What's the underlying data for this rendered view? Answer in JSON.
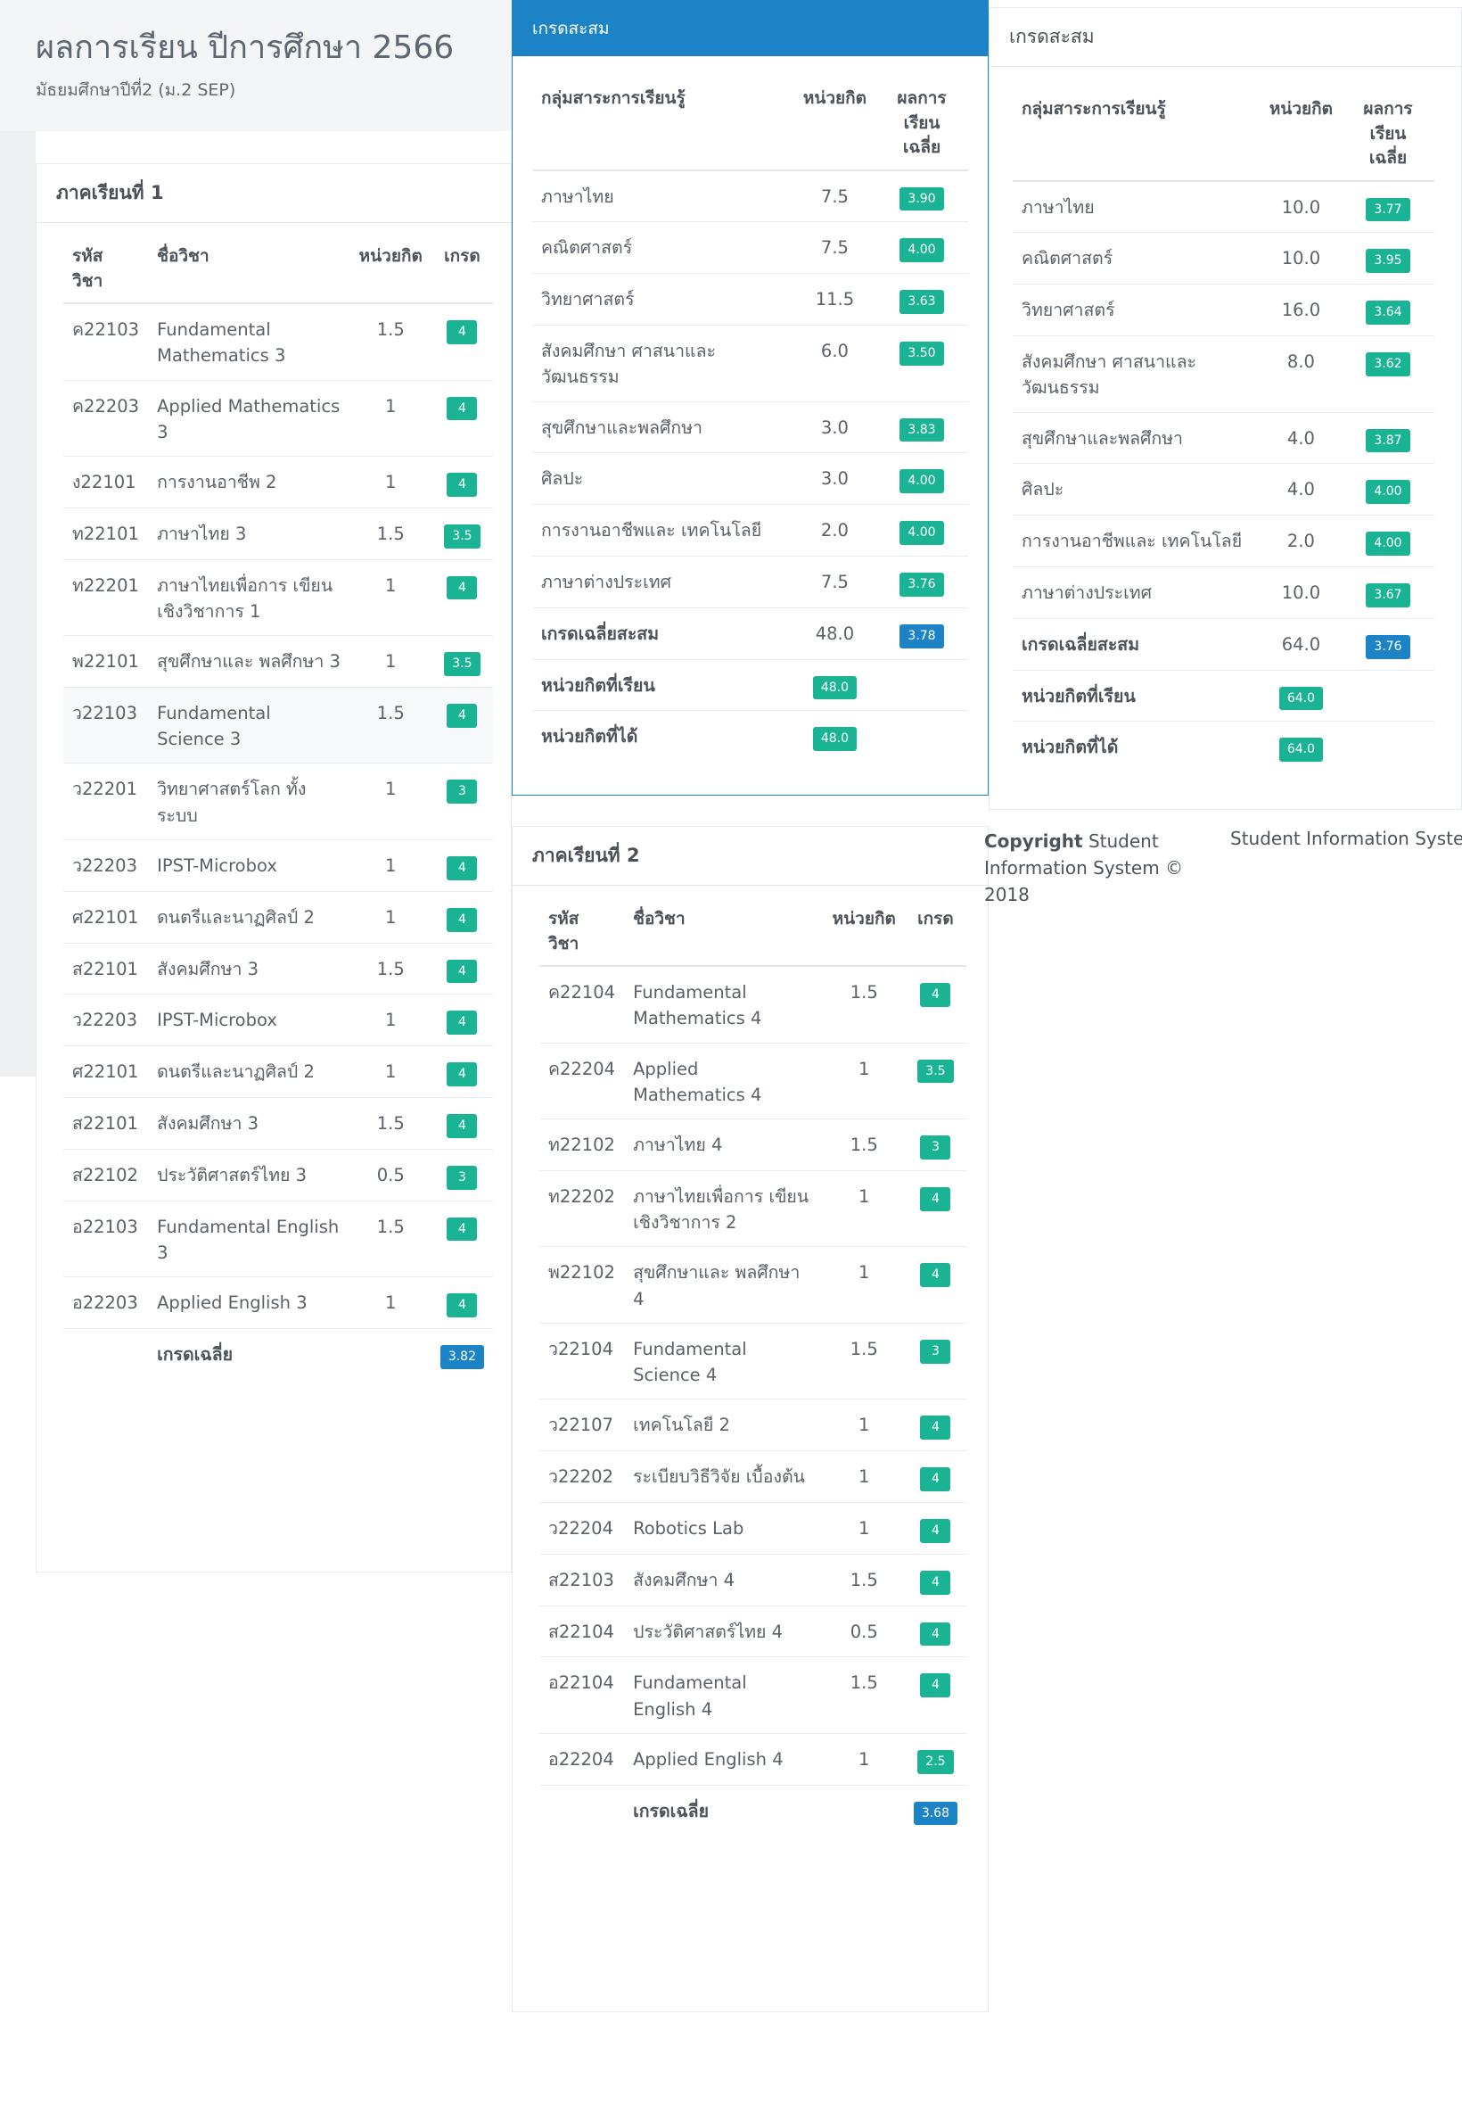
{
  "page": {
    "title": "ผลการเรียน ปีการศึกษา 2566",
    "subtitle": "มัธยมศึกษาปีที่2 (ม.2 SEP)"
  },
  "colors": {
    "green": "#1ab394",
    "blue": "#1c84c6"
  },
  "term1": {
    "heading": "ภาคเรียนที่ 1",
    "headers": {
      "code": "รหัส วิชา",
      "name": "ชื่อวิชา",
      "credit": "หน่วยกิต",
      "grade": "เกรด"
    },
    "rows": [
      {
        "code": "ค22103",
        "name": "Fundamental Mathematics 3",
        "credit": "1.5",
        "grade": "4"
      },
      {
        "code": "ค22203",
        "name": "Applied Mathematics 3",
        "credit": "1",
        "grade": "4"
      },
      {
        "code": "ง22101",
        "name": "การงานอาชีพ 2",
        "credit": "1",
        "grade": "4"
      },
      {
        "code": "ท22101",
        "name": "ภาษาไทย 3",
        "credit": "1.5",
        "grade": "3.5"
      },
      {
        "code": "ท22201",
        "name": "ภาษาไทยเพื่อการ เขียนเชิงวิชาการ 1",
        "credit": "1",
        "grade": "4"
      },
      {
        "code": "พ22101",
        "name": "สุขศึกษาและ พลศึกษา 3",
        "credit": "1",
        "grade": "3.5"
      },
      {
        "code": "ว22103",
        "name": "Fundamental Science 3",
        "credit": "1.5",
        "grade": "4"
      },
      {
        "code": "ว22201",
        "name": "วิทยาศาสตร์โลก ทั้งระบบ",
        "credit": "1",
        "grade": "3"
      },
      {
        "code": "ว22203",
        "name": "IPST-Microbox",
        "credit": "1",
        "grade": "4"
      },
      {
        "code": "ศ22101",
        "name": "ดนตรีและนาฏศิลป์ 2",
        "credit": "1",
        "grade": "4"
      },
      {
        "code": "ส22101",
        "name": "สังคมศึกษา 3",
        "credit": "1.5",
        "grade": "4"
      },
      {
        "code": "ว22203",
        "name": "IPST-Microbox",
        "credit": "1",
        "grade": "4"
      },
      {
        "code": "ศ22101",
        "name": "ดนตรีและนาฏศิลป์ 2",
        "credit": "1",
        "grade": "4"
      },
      {
        "code": "ส22101",
        "name": "สังคมศึกษา 3",
        "credit": "1.5",
        "grade": "4"
      },
      {
        "code": "ส22102",
        "name": "ประวัติศาสตร์ไทย 3",
        "credit": "0.5",
        "grade": "3"
      },
      {
        "code": "อ22103",
        "name": "Fundamental English 3",
        "credit": "1.5",
        "grade": "4"
      },
      {
        "code": "อ22203",
        "name": "Applied English 3",
        "credit": "1",
        "grade": "4"
      }
    ],
    "gpa_label": "เกรดเฉลี่ย",
    "gpa": "3.82"
  },
  "term2": {
    "heading": "ภาคเรียนที่ 2",
    "headers": {
      "code": "รหัส วิชา",
      "name": "ชื่อวิชา",
      "credit": "หน่วยกิต",
      "grade": "เกรด"
    },
    "rows": [
      {
        "code": "ค22104",
        "name": "Fundamental Mathematics 4",
        "credit": "1.5",
        "grade": "4"
      },
      {
        "code": "ค22204",
        "name": "Applied Mathematics 4",
        "credit": "1",
        "grade": "3.5"
      },
      {
        "code": "ท22102",
        "name": "ภาษาไทย 4",
        "credit": "1.5",
        "grade": "3"
      },
      {
        "code": "ท22202",
        "name": "ภาษาไทยเพื่อการ เขียนเชิงวิชาการ 2",
        "credit": "1",
        "grade": "4"
      },
      {
        "code": "พ22102",
        "name": "สุขศึกษาและ พลศึกษา 4",
        "credit": "1",
        "grade": "4"
      },
      {
        "code": "ว22104",
        "name": "Fundamental Science 4",
        "credit": "1.5",
        "grade": "3"
      },
      {
        "code": "ว22107",
        "name": "เทคโนโลยี 2",
        "credit": "1",
        "grade": "4"
      },
      {
        "code": "ว22202",
        "name": "ระเบียบวิธีวิจัย เบื้องต้น",
        "credit": "1",
        "grade": "4"
      },
      {
        "code": "ว22204",
        "name": "Robotics Lab",
        "credit": "1",
        "grade": "4"
      },
      {
        "code": "ส22103",
        "name": "สังคมศึกษา 4",
        "credit": "1.5",
        "grade": "4"
      },
      {
        "code": "ส22104",
        "name": "ประวัติศาสตร์ไทย 4",
        "credit": "0.5",
        "grade": "4"
      },
      {
        "code": "อ22104",
        "name": "Fundamental English 4",
        "credit": "1.5",
        "grade": "4"
      },
      {
        "code": "อ22204",
        "name": "Applied English 4",
        "credit": "1",
        "grade": "2.5"
      }
    ],
    "gpa_label": "เกรดเฉลี่ย",
    "gpa": "3.68"
  },
  "cum1": {
    "heading": "เกรดสะสม",
    "headers": {
      "group": "กลุ่มสาระการเรียนรู้",
      "credit": "หน่วยกิต",
      "avg": "ผลการเรียน เฉลี่ย"
    },
    "rows": [
      {
        "group": "ภาษาไทย",
        "credit": "7.5",
        "avg": "3.90"
      },
      {
        "group": "คณิตศาสตร์",
        "credit": "7.5",
        "avg": "4.00"
      },
      {
        "group": "วิทยาศาสตร์",
        "credit": "11.5",
        "avg": "3.63"
      },
      {
        "group": "สังคมศึกษา ศาสนาและ วัฒนธรรม",
        "credit": "6.0",
        "avg": "3.50"
      },
      {
        "group": "สุขศึกษาและพลศึกษา",
        "credit": "3.0",
        "avg": "3.83"
      },
      {
        "group": "ศิลปะ",
        "credit": "3.0",
        "avg": "4.00"
      },
      {
        "group": "การงานอาชีพและ เทคโนโลยี",
        "credit": "2.0",
        "avg": "4.00"
      },
      {
        "group": "ภาษาต่างประเทศ",
        "credit": "7.5",
        "avg": "3.76"
      }
    ],
    "cum_label": "เกรดเฉลี่ยสะสม",
    "cum_credit": "48.0",
    "cum_gpa": "3.78",
    "credits_studied_label": "หน่วยกิตที่เรียน",
    "credits_studied": "48.0",
    "credits_earned_label": "หน่วยกิตที่ได้",
    "credits_earned": "48.0"
  },
  "cum2": {
    "heading": "เกรดสะสม",
    "headers": {
      "group": "กลุ่มสาระการเรียนรู้",
      "credit": "หน่วยกิต",
      "avg": "ผลการเรียน เฉลี่ย"
    },
    "rows": [
      {
        "group": "ภาษาไทย",
        "credit": "10.0",
        "avg": "3.77"
      },
      {
        "group": "คณิตศาสตร์",
        "credit": "10.0",
        "avg": "3.95"
      },
      {
        "group": "วิทยาศาสตร์",
        "credit": "16.0",
        "avg": "3.64"
      },
      {
        "group": "สังคมศึกษา ศาสนาและ วัฒนธรรม",
        "credit": "8.0",
        "avg": "3.62"
      },
      {
        "group": "สุขศึกษาและพลศึกษา",
        "credit": "4.0",
        "avg": "3.87"
      },
      {
        "group": "ศิลปะ",
        "credit": "4.0",
        "avg": "4.00"
      },
      {
        "group": "การงานอาชีพและ เทคโนโลยี",
        "credit": "2.0",
        "avg": "4.00"
      },
      {
        "group": "ภาษาต่างประเทศ",
        "credit": "10.0",
        "avg": "3.67"
      }
    ],
    "cum_label": "เกรดเฉลี่ยสะสม",
    "cum_credit": "64.0",
    "cum_gpa": "3.76",
    "credits_studied_label": "หน่วยกิตที่เรียน",
    "credits_studied": "64.0",
    "credits_earned_label": "หน่วยกิตที่ได้",
    "credits_earned": "64.0"
  },
  "footer": {
    "copyright_bold": "Copyright",
    "copyright_rest": " Student Information System © 2018",
    "system_name": "Student Information System"
  }
}
